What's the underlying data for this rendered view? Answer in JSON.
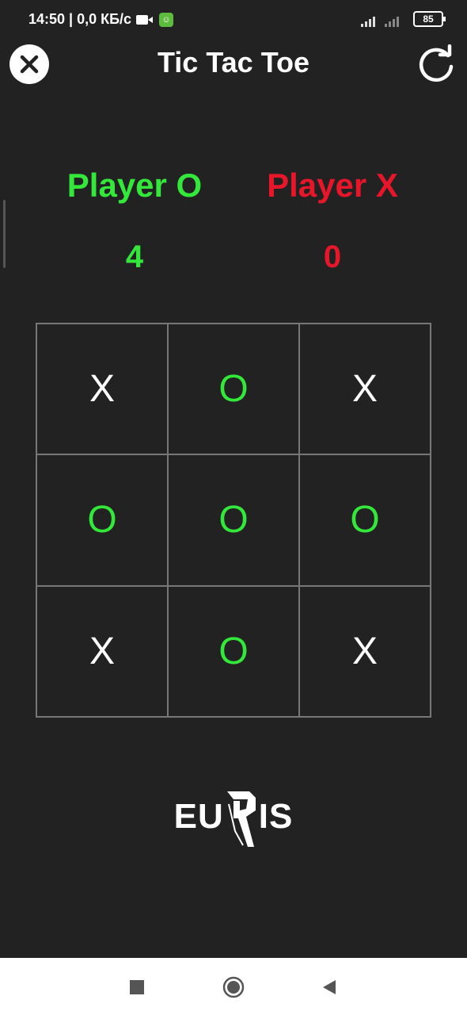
{
  "status_bar": {
    "time_info": "14:50 | 0,0 КБ/с",
    "network": "4G",
    "battery": "85"
  },
  "app_bar": {
    "title": "Tic Tac Toe"
  },
  "players": {
    "o": {
      "name": "Player O",
      "score": "4",
      "color": "#33e83a"
    },
    "x": {
      "name": "Player X",
      "score": "0",
      "color": "#e8162a"
    }
  },
  "board": {
    "cells": [
      "X",
      "O",
      "X",
      "O",
      "O",
      "O",
      "X",
      "O",
      "X"
    ]
  },
  "logo": {
    "left": "EU",
    "right": "IS"
  },
  "colors": {
    "background": "#222222",
    "o_mark": "#33e83a",
    "x_mark": "#ffffff",
    "grid": "#777777"
  }
}
